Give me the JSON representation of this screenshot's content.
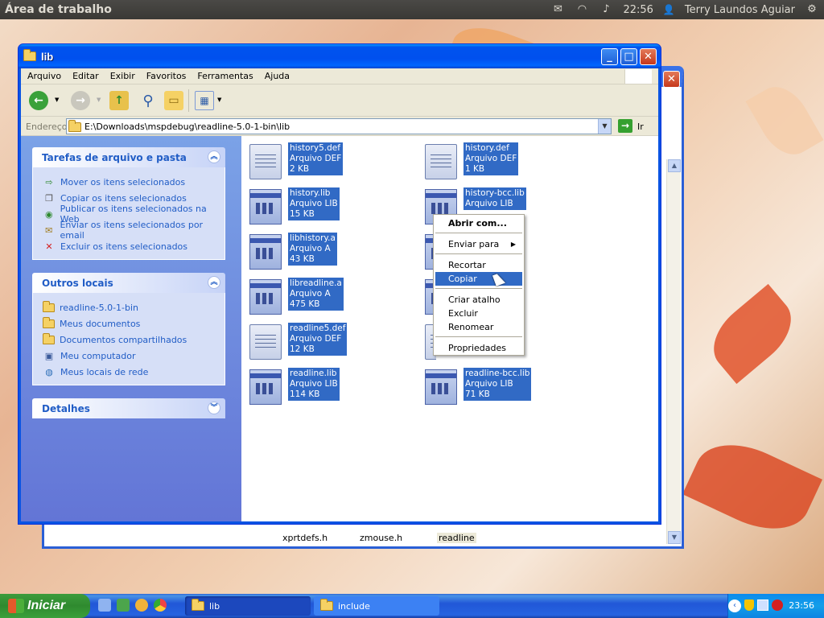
{
  "desktop": {
    "topbar_title": "Área de trabalho",
    "clock": "22:56",
    "user": "Terry Laundos Aguiar"
  },
  "window": {
    "title": "lib",
    "menu": [
      "Arquivo",
      "Editar",
      "Exibir",
      "Favoritos",
      "Ferramentas",
      "Ajuda"
    ],
    "address_label": "Endereço",
    "address": "E:\\Downloads\\mspdebug\\readline-5.0-1-bin\\lib",
    "go_label": "Ir"
  },
  "tasks_panel": {
    "title": "Tarefas de arquivo e pasta",
    "items": [
      {
        "label": "Mover os itens selecionados",
        "icon": "move-icon"
      },
      {
        "label": "Copiar os itens selecionados",
        "icon": "copy-icon"
      },
      {
        "label": "Publicar os itens selecionados na Web",
        "icon": "globe-icon"
      },
      {
        "label": "Enviar os itens selecionados por email",
        "icon": "email-icon"
      },
      {
        "label": "Excluir os itens selecionados",
        "icon": "delete-icon"
      }
    ]
  },
  "places_panel": {
    "title": "Outros locais",
    "items": [
      {
        "label": "readline-5.0-1-bin",
        "icon": "folder-icon"
      },
      {
        "label": "Meus documentos",
        "icon": "folder-icon"
      },
      {
        "label": "Documentos compartilhados",
        "icon": "folder-icon"
      },
      {
        "label": "Meu computador",
        "icon": "computer-icon"
      },
      {
        "label": "Meus locais de rede",
        "icon": "network-icon"
      }
    ]
  },
  "details_panel": {
    "title": "Detalhes"
  },
  "files": [
    {
      "name": "history5.def",
      "type": "Arquivo DEF",
      "size": "2 KB",
      "kind": "doc"
    },
    {
      "name": "history.def",
      "type": "Arquivo DEF",
      "size": "1 KB",
      "kind": "doc"
    },
    {
      "name": "history.lib",
      "type": "Arquivo LIB",
      "size": "15 KB",
      "kind": "lib"
    },
    {
      "name": "history-bcc.lib",
      "type": "Arquivo LIB",
      "size": "",
      "kind": "lib"
    },
    {
      "name": "libhistory.a",
      "type": "Arquivo A",
      "size": "43 KB",
      "kind": "lib"
    },
    {
      "name": "libreadline.a",
      "type": "Arquivo A",
      "size": "475 KB",
      "kind": "lib"
    },
    {
      "name": "readline5.def",
      "type": "Arquivo DEF",
      "size": "12 KB",
      "kind": "doc"
    },
    {
      "name": "readline.lib",
      "type": "Arquivo LIB",
      "size": "114 KB",
      "kind": "lib"
    },
    {
      "name": "readline-bcc.lib",
      "type": "Arquivo LIB",
      "size": "71 KB",
      "kind": "lib"
    }
  ],
  "context_menu": {
    "open_with": "Abrir com...",
    "send_to": "Enviar para",
    "cut": "Recortar",
    "copy": "Copiar",
    "create_shortcut": "Criar atalho",
    "delete": "Excluir",
    "rename": "Renomear",
    "properties": "Propriedades"
  },
  "back_window": {
    "files": [
      "xprtdefs.h",
      "zmouse.h",
      "readline"
    ]
  },
  "taskbar": {
    "start_label": "Iniciar",
    "tasks": [
      "lib",
      "include"
    ],
    "clock": "23:56"
  }
}
